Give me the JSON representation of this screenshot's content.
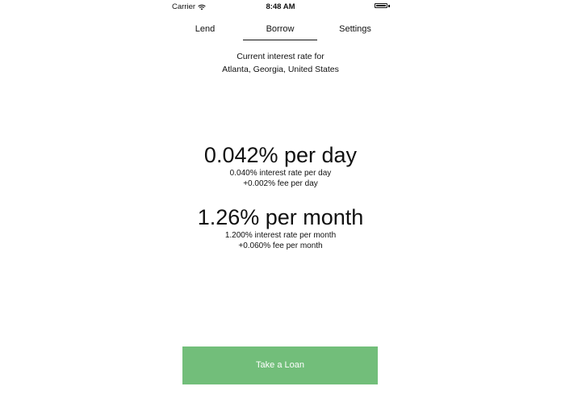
{
  "status_bar": {
    "carrier": "Carrier",
    "time": "8:48 AM"
  },
  "tabs": [
    {
      "label": "Lend"
    },
    {
      "label": "Borrow",
      "selected": true
    },
    {
      "label": "Settings"
    }
  ],
  "location": {
    "line1": "Current interest rate for",
    "line2": "Atlanta, Georgia, United States"
  },
  "rates": {
    "day": {
      "headline": "0.042% per day",
      "interest": "0.040% interest rate per day",
      "fee": "+0.002% fee per day"
    },
    "month": {
      "headline": "1.26% per month",
      "interest": "1.200% interest rate per month",
      "fee": "+0.060% fee per month"
    }
  },
  "action": {
    "label": "Take a Loan"
  },
  "colors": {
    "button_bg": "#72be7a",
    "button_text": "#ffffff"
  },
  "icons": [
    "wifi-icon",
    "battery-icon"
  ]
}
